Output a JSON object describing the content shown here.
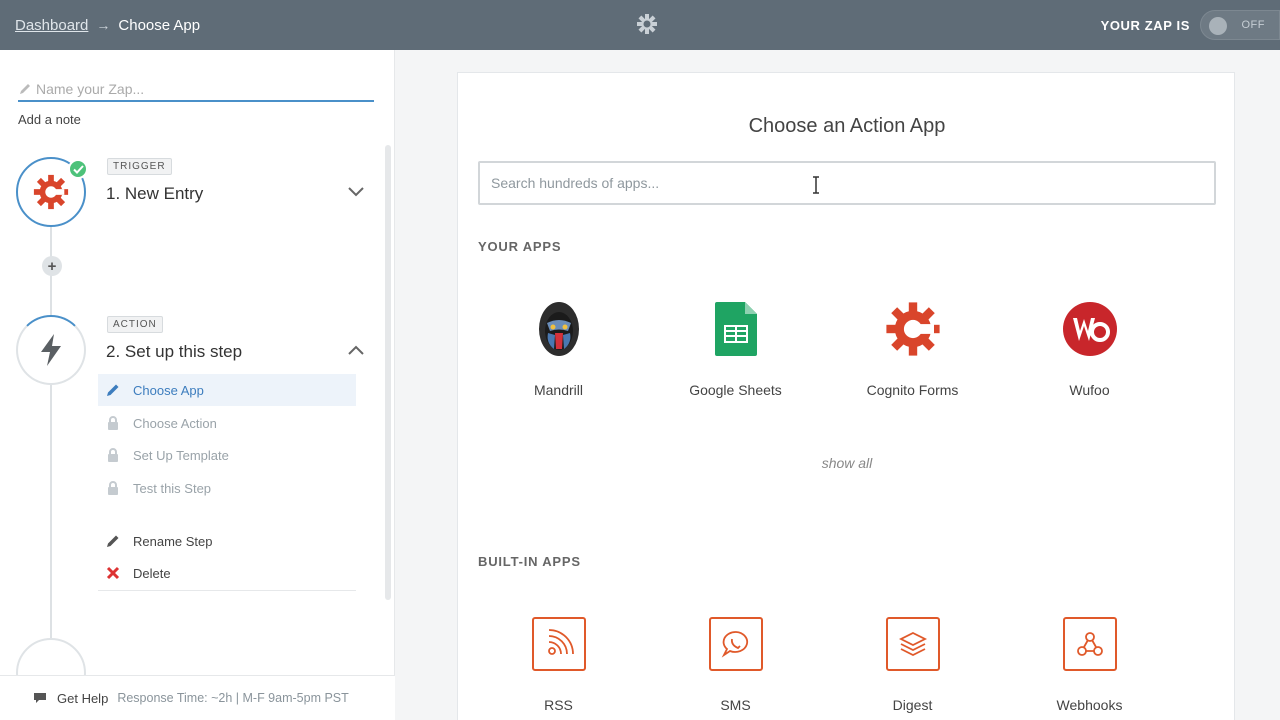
{
  "topbar": {
    "breadcrumb_root": "Dashboard",
    "breadcrumb_arrow": "→",
    "breadcrumb_current": "Choose App",
    "status_label": "YOUR ZAP IS",
    "toggle_state": "OFF"
  },
  "sidebar": {
    "zap_name_placeholder": "Name your Zap...",
    "add_note": "Add a note",
    "trigger": {
      "tag": "TRIGGER",
      "title": "1. New Entry"
    },
    "action": {
      "tag": "ACTION",
      "title": "2. Set up this step",
      "items": [
        {
          "label": "Choose App",
          "state": "active",
          "icon": "pencil-icon"
        },
        {
          "label": "Choose Action",
          "state": "locked",
          "icon": "lock-icon"
        },
        {
          "label": "Set Up Template",
          "state": "locked",
          "icon": "lock-icon"
        },
        {
          "label": "Test this Step",
          "state": "locked",
          "icon": "lock-icon"
        }
      ],
      "rename": "Rename Step",
      "delete": "Delete"
    },
    "help": {
      "label": "Get Help",
      "response_time": "Response Time: ~2h | M-F 9am-5pm PST"
    }
  },
  "main": {
    "title": "Choose an Action App",
    "search_placeholder": "Search hundreds of apps...",
    "your_apps_label": "YOUR APPS",
    "your_apps": [
      {
        "name": "Mandrill",
        "icon": "mandrill-icon"
      },
      {
        "name": "Google Sheets",
        "icon": "google-sheets-icon"
      },
      {
        "name": "Cognito Forms",
        "icon": "cognito-forms-icon"
      },
      {
        "name": "Wufoo",
        "icon": "wufoo-icon"
      }
    ],
    "show_all": "show all",
    "builtin_label": "BUILT-IN APPS",
    "builtin_apps": [
      {
        "name": "RSS",
        "icon": "rss-icon"
      },
      {
        "name": "SMS",
        "icon": "sms-icon"
      },
      {
        "name": "Digest",
        "icon": "digest-icon"
      },
      {
        "name": "Webhooks",
        "icon": "webhooks-icon"
      }
    ]
  },
  "colors": {
    "topbar": "#5f6c77",
    "accent_blue": "#4a90c9",
    "zapier_orange": "#e0592a",
    "check_green": "#4dc27a",
    "delete_red": "#d33"
  }
}
